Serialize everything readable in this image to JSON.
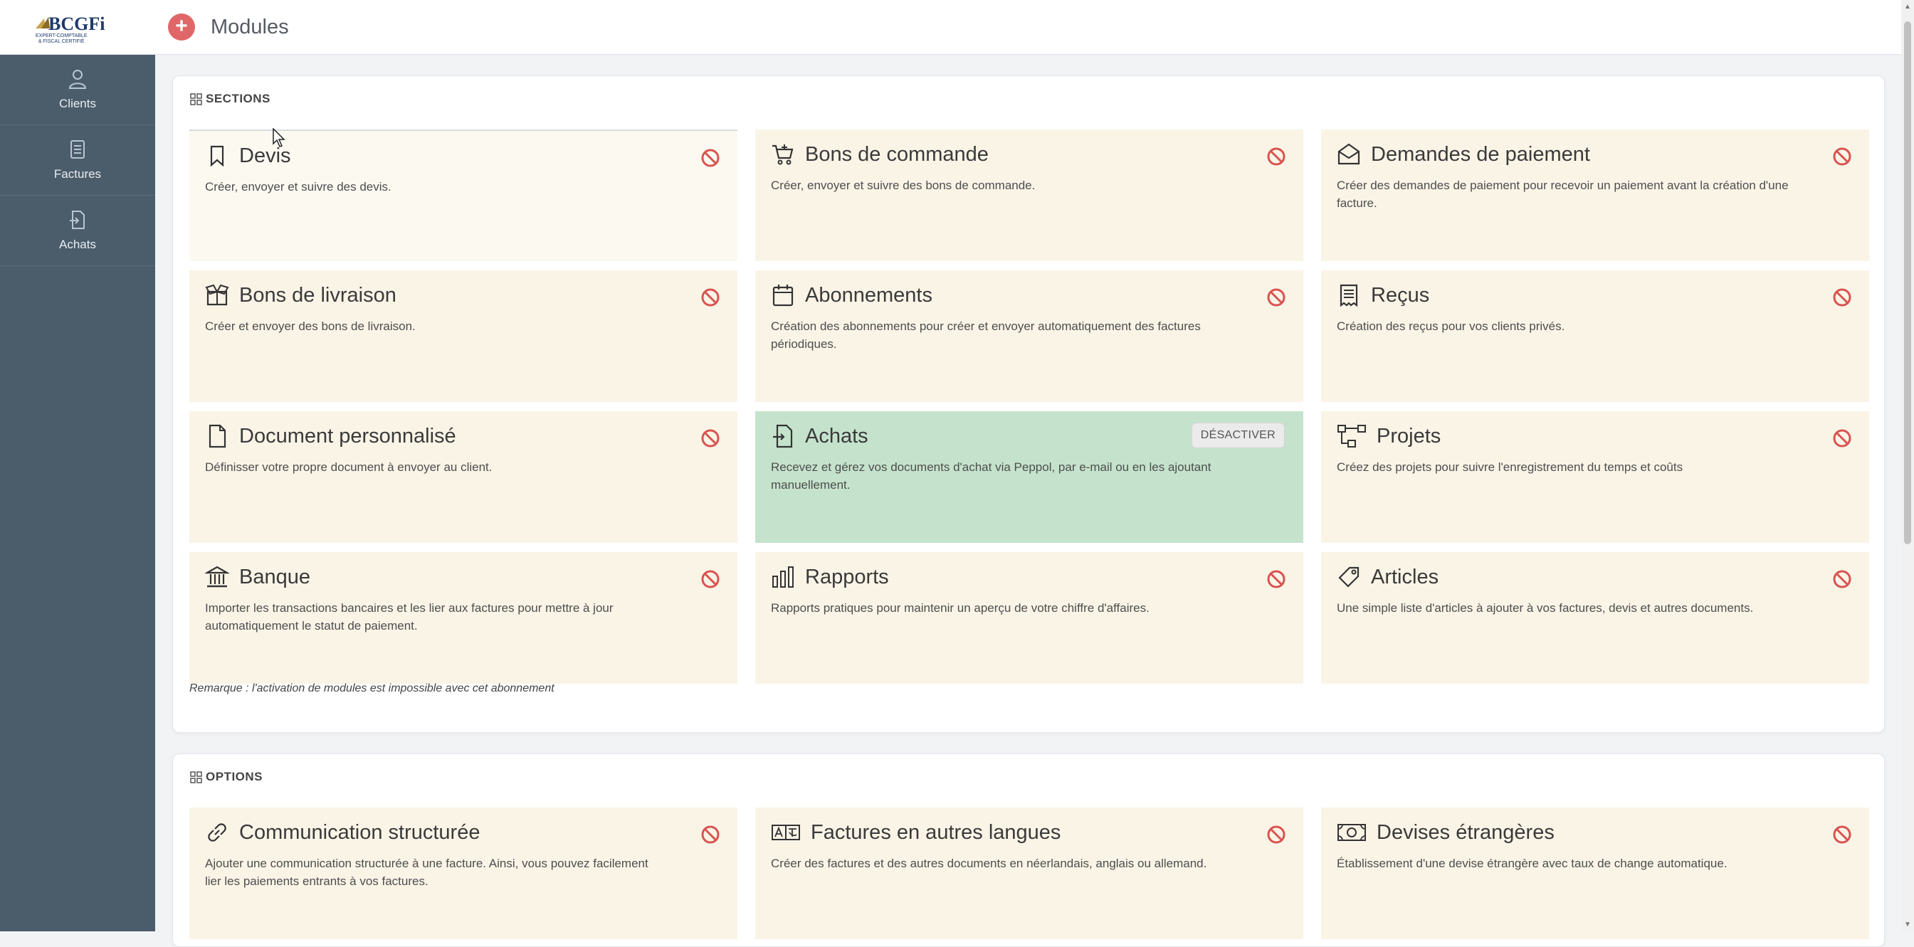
{
  "logo": {
    "text": "BCGFi",
    "subtitle_line1": "EXPERT-COMPTABLE",
    "subtitle_line2": "& FISCAL CERTIFIÉ"
  },
  "topbar": {
    "add_label": "+",
    "title": "Modules"
  },
  "sidebar": {
    "items": [
      {
        "label": "Clients",
        "icon": "user-icon"
      },
      {
        "label": "Factures",
        "icon": "invoice-icon"
      },
      {
        "label": "Achats",
        "icon": "purchase-icon"
      }
    ]
  },
  "sections": {
    "heading": "SECTIONS",
    "cards": [
      {
        "title": "Devis",
        "desc": "Créer, envoyer et suivre des devis.",
        "icon": "bookmark-icon",
        "active": false
      },
      {
        "title": "Bons de commande",
        "desc": "Créer, envoyer et suivre des bons de commande.",
        "icon": "cart-icon",
        "active": false
      },
      {
        "title": "Demandes de paiement",
        "desc": "Créer des demandes de paiement pour recevoir un paiement avant la création d'une facture.",
        "icon": "envelope-open-icon",
        "active": false
      },
      {
        "title": "Bons de livraison",
        "desc": "Créer et envoyer des bons de livraison.",
        "icon": "box-icon",
        "active": false
      },
      {
        "title": "Abonnements",
        "desc": "Création des abonnements pour créer et envoyer automatiquement des factures périodiques.",
        "icon": "calendar-icon",
        "active": false
      },
      {
        "title": "Reçus",
        "desc": "Création des reçus pour vos clients privés.",
        "icon": "receipt-icon",
        "active": false
      },
      {
        "title": "Document personnalisé",
        "desc": "Définisser votre propre document à envoyer au client.",
        "icon": "file-icon",
        "active": false
      },
      {
        "title": "Achats",
        "desc": "Recevez et gérez vos documents d'achat via Peppol, par e-mail ou en les ajoutant manuellement.",
        "icon": "file-import-icon",
        "active": true,
        "button": "DÉSACTIVER"
      },
      {
        "title": "Projets",
        "desc": "Créez des projets pour suivre l'enregistrement du temps et coûts",
        "icon": "project-icon",
        "active": false
      },
      {
        "title": "Banque",
        "desc": "Importer les transactions bancaires et les lier aux factures pour mettre à jour automatiquement le statut de paiement.",
        "icon": "bank-icon",
        "active": false
      },
      {
        "title": "Rapports",
        "desc": "Rapports pratiques pour maintenir un aperçu de votre chiffre d'affaires.",
        "icon": "chart-icon",
        "active": false
      },
      {
        "title": "Articles",
        "desc": "Une simple liste d'articles à ajouter à vos factures, devis et autres documents.",
        "icon": "tag-icon",
        "active": false
      }
    ],
    "remark": "Remarque : l'activation de modules est impossible avec cet abonnement"
  },
  "options": {
    "heading": "OPTIONS",
    "cards": [
      {
        "title": "Communication structurée",
        "desc": "Ajouter une communication structurée à une facture. Ainsi, vous pouvez facilement lier les paiements entrants à vos factures.",
        "icon": "link-icon",
        "active": false
      },
      {
        "title": "Factures en autres langues",
        "desc": "Créer des factures et des autres documents en néerlandais, anglais ou allemand.",
        "icon": "language-icon",
        "active": false
      },
      {
        "title": "Devises étrangères",
        "desc": "Établissement d'une devise étrangère avec taux de change automatique.",
        "icon": "money-icon",
        "active": false
      }
    ]
  },
  "colors": {
    "sidebar": "#4b5c6b",
    "card": "#faf4e7",
    "active_card": "#c5e3cc",
    "ban": "#d9534f",
    "add_button": "#e06767"
  }
}
